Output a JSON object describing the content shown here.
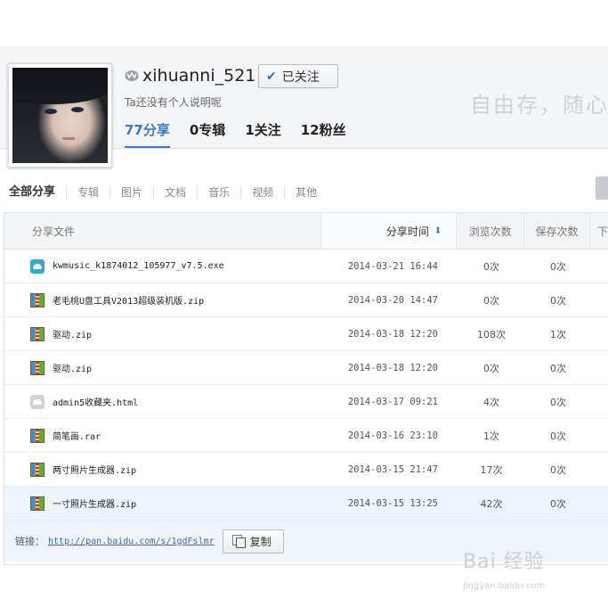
{
  "profile": {
    "username": "xihuanni_521",
    "follow_label": "已关注",
    "bio": "Ta还没有个人说明呢",
    "slogan": "自由存，随心",
    "stats": [
      {
        "label": "77分享",
        "active": true
      },
      {
        "label": "0专辑",
        "active": false
      },
      {
        "label": "1关注",
        "active": false
      },
      {
        "label": "12粉丝",
        "active": false
      }
    ]
  },
  "filters": [
    "全部分享",
    "专辑",
    "图片",
    "文档",
    "音乐",
    "视频",
    "其他"
  ],
  "table": {
    "columns": {
      "file": "分享文件",
      "time": "分享时间",
      "views": "浏览次数",
      "saves": "保存次数",
      "more": "下"
    },
    "rows": [
      {
        "icon": "exe",
        "name": "kwmusic_k1874012_105977_v7.5.exe",
        "time": "2014-03-21 16:44",
        "views": "0次",
        "saves": "0次"
      },
      {
        "icon": "zip",
        "name": "老毛桃U盘工具V2013超级装机版.zip",
        "time": "2014-03-20 14:47",
        "views": "0次",
        "saves": "0次"
      },
      {
        "icon": "zip",
        "name": "驱动.zip",
        "time": "2014-03-18 12:20",
        "views": "108次",
        "saves": "1次"
      },
      {
        "icon": "zip",
        "name": "驱动.zip",
        "time": "2014-03-18 12:20",
        "views": "0次",
        "saves": "0次"
      },
      {
        "icon": "html",
        "name": "admin5收藏夹.html",
        "time": "2014-03-17 09:21",
        "views": "4次",
        "saves": "0次"
      },
      {
        "icon": "zip",
        "name": "简笔画.rar",
        "time": "2014-03-16 23:10",
        "views": "1次",
        "saves": "0次"
      },
      {
        "icon": "zip",
        "name": "两寸照片生成器.zip",
        "time": "2014-03-15 21:47",
        "views": "17次",
        "saves": "0次"
      },
      {
        "icon": "zip",
        "name": "一寸照片生成器.zip",
        "time": "2014-03-15 13:25",
        "views": "42次",
        "saves": "0次"
      }
    ]
  },
  "link_bar": {
    "label": "链接：",
    "url": "http://pan.baidu.com/s/1gdFslmr",
    "copy_label": "复制"
  },
  "watermark": {
    "logo": "Bai 经验",
    "url": "jingyan.baidu.com"
  }
}
